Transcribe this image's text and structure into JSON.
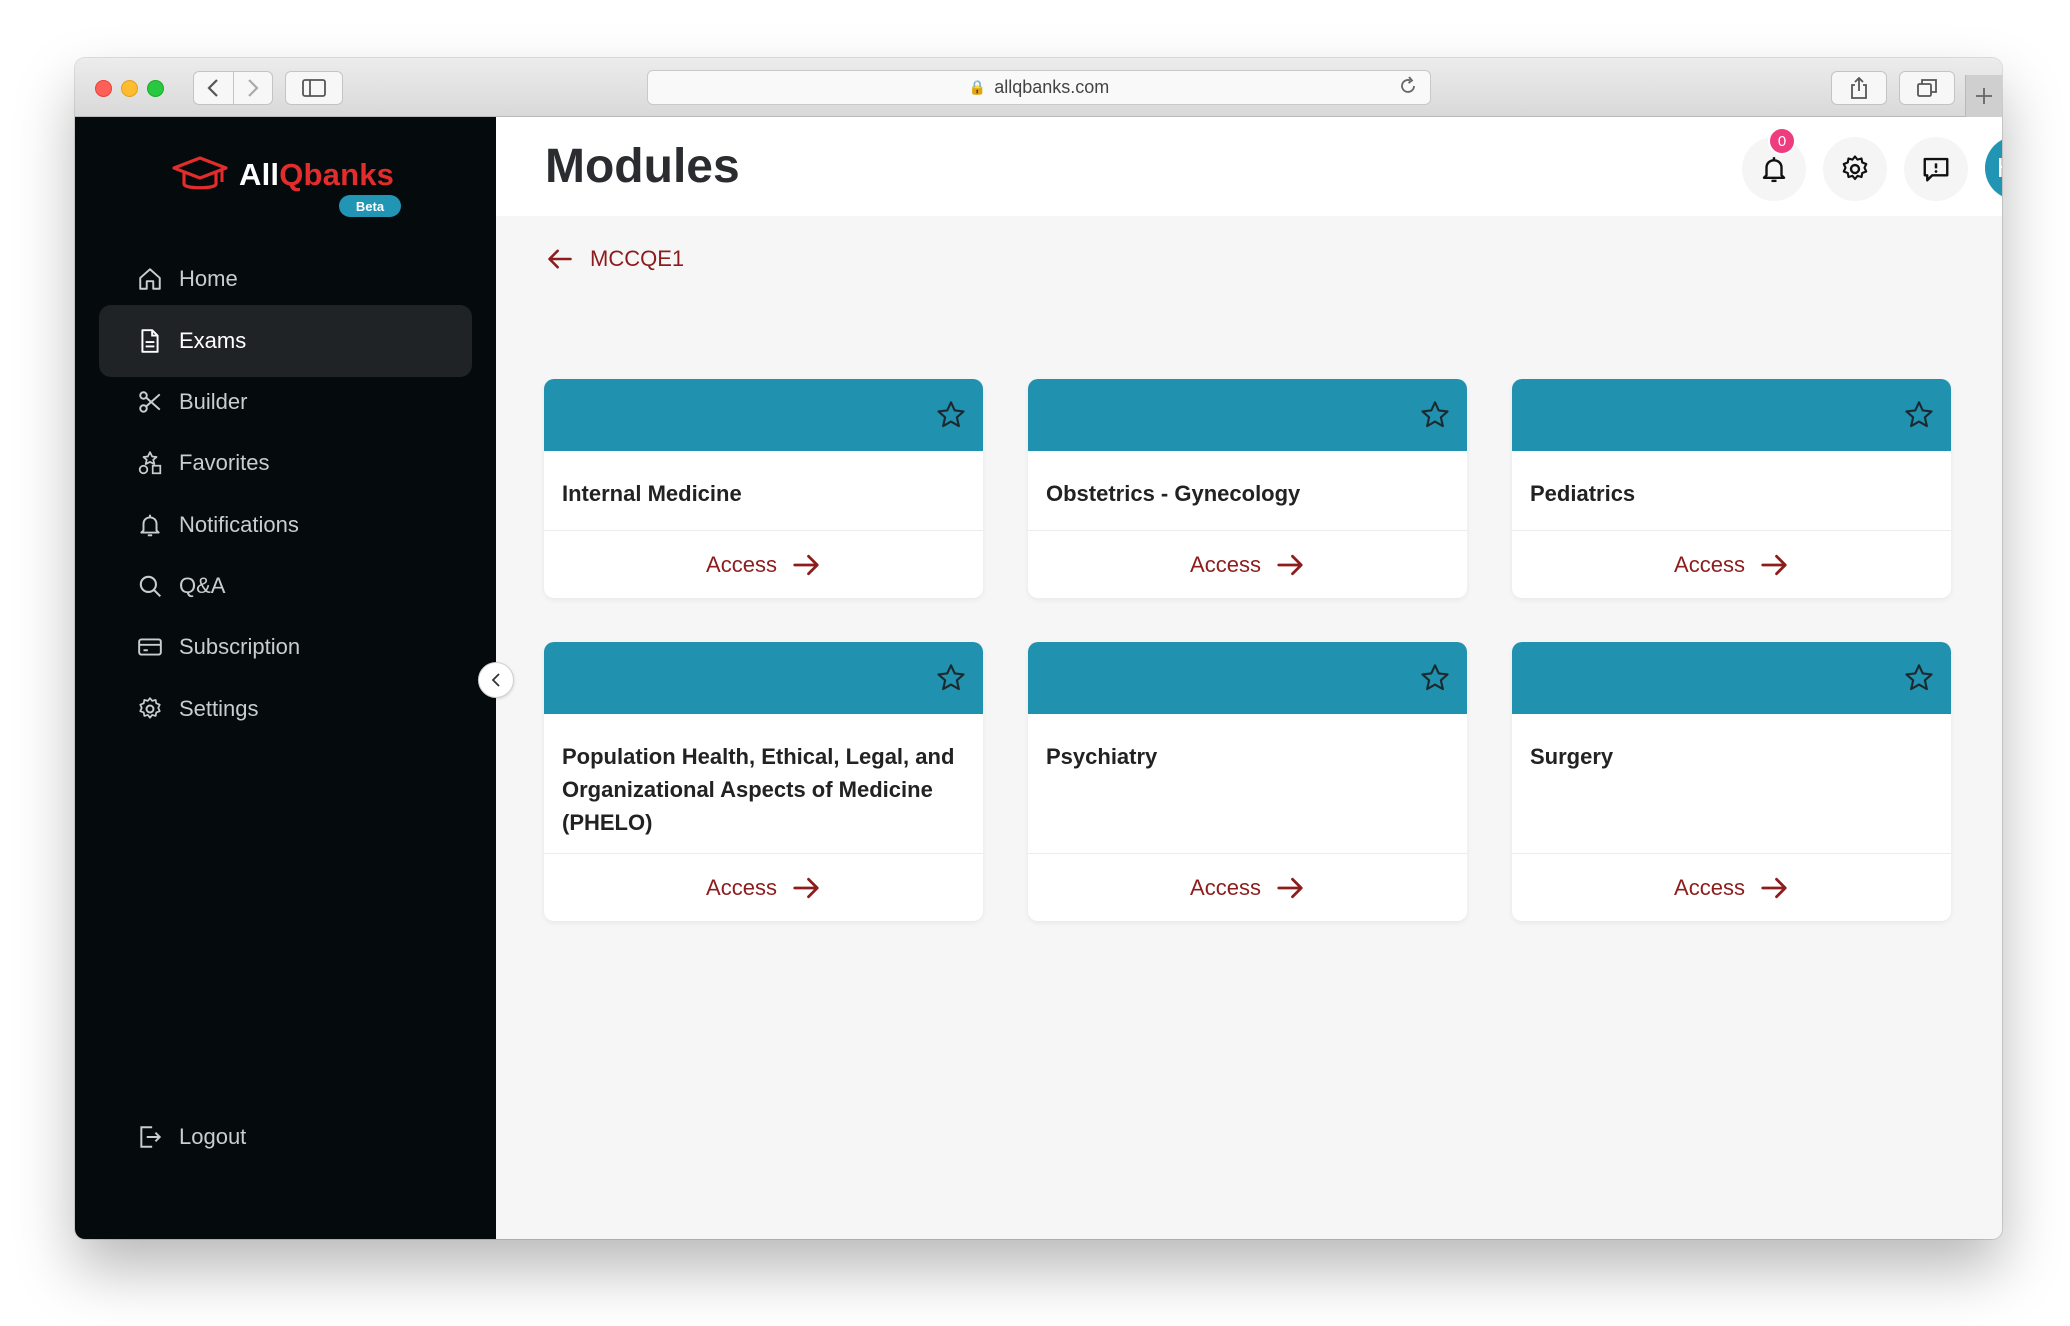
{
  "browser": {
    "url": "allqbanks.com"
  },
  "brand": {
    "name_part1": "All",
    "name_part2": "Qbanks",
    "badge": "Beta"
  },
  "sidebar": {
    "items": [
      {
        "label": "Home",
        "icon": "home-icon"
      },
      {
        "label": "Exams",
        "icon": "document-icon",
        "active": true
      },
      {
        "label": "Builder",
        "icon": "scissors-icon"
      },
      {
        "label": "Favorites",
        "icon": "shapes-icon"
      },
      {
        "label": "Notifications",
        "icon": "bell-icon"
      },
      {
        "label": "Q&A",
        "icon": "search-icon"
      },
      {
        "label": "Subscription",
        "icon": "card-icon"
      },
      {
        "label": "Settings",
        "icon": "gear-icon"
      }
    ],
    "logout": "Logout"
  },
  "header": {
    "title": "Modules",
    "notification_count": "0",
    "avatar_initials": "HC"
  },
  "breadcrumb": {
    "label": "MCCQE1"
  },
  "modules": [
    {
      "title": "Internal Medicine",
      "action": "Access"
    },
    {
      "title": "Obstetrics - Gynecology",
      "action": "Access"
    },
    {
      "title": "Pediatrics",
      "action": "Access"
    },
    {
      "title": "Population Health, Ethical, Legal, and Organizational Aspects of Medicine (PHELO)",
      "action": "Access"
    },
    {
      "title": "Psychiatry",
      "action": "Access"
    },
    {
      "title": "Surgery",
      "action": "Access"
    }
  ],
  "colors": {
    "accent": "#2091ae",
    "link": "#8d1c1c",
    "sidebar_bg": "#050a0c",
    "brand_red": "#e32c2c",
    "badge": "#ee3c7f"
  }
}
